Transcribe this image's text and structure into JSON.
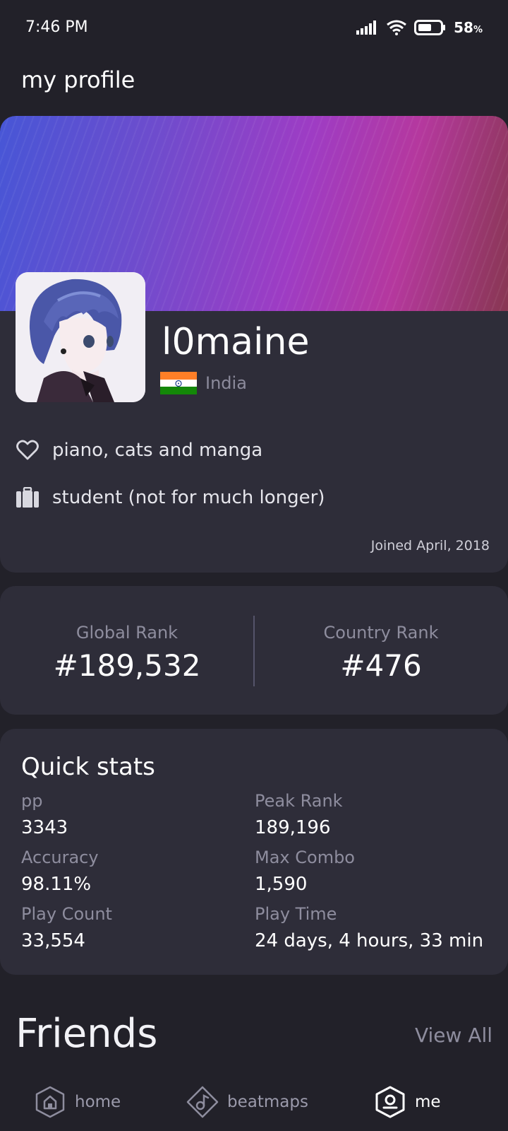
{
  "status_bar": {
    "time": "7:46 PM",
    "battery_percent": "58",
    "battery_unit": "%",
    "icons": [
      "signal-icon",
      "wifi-icon",
      "battery-icon"
    ]
  },
  "header": {
    "title": "my profile"
  },
  "profile": {
    "username": "l0maine",
    "country": "India",
    "interests": "piano, cats and manga",
    "occupation": "student (not for much longer)",
    "joined": "Joined April, 2018",
    "banner_colors": [
      "#4756d6",
      "#9e3cc4",
      "#883752"
    ]
  },
  "ranks": {
    "global_label": "Global Rank",
    "global_value": "#189,532",
    "country_label": "Country Rank",
    "country_value": "#476"
  },
  "quick_stats": {
    "title": "Quick stats",
    "items": [
      {
        "label": "pp",
        "value": "3343"
      },
      {
        "label": "Peak Rank",
        "value": "189,196"
      },
      {
        "label": "Accuracy",
        "value": "98.11%"
      },
      {
        "label": "Max Combo",
        "value": "1,590"
      },
      {
        "label": "Play Count",
        "value": "33,554"
      },
      {
        "label": "Play Time",
        "value": "24 days, 4 hours, 33 min"
      }
    ]
  },
  "friends": {
    "title": "Friends",
    "view_all": "View All"
  },
  "bottom_nav": {
    "items": [
      {
        "label": "home",
        "icon": "home-icon",
        "active": false
      },
      {
        "label": "beatmaps",
        "icon": "beatmaps-icon",
        "active": false
      },
      {
        "label": "me",
        "icon": "profile-icon",
        "active": true
      }
    ]
  },
  "colors": {
    "background": "#222129",
    "card": "#2e2d39",
    "muted_text": "#8e8d9e"
  }
}
